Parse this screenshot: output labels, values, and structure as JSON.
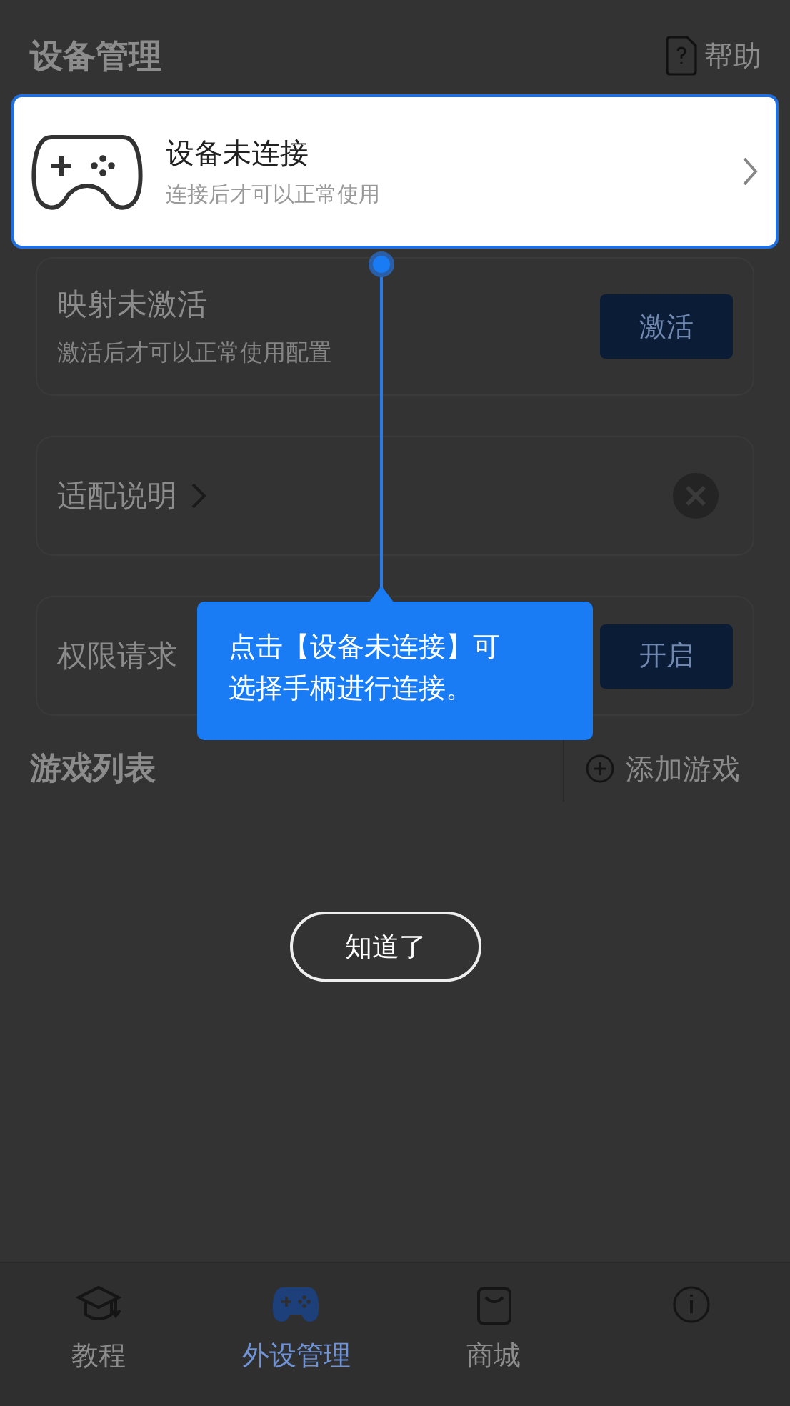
{
  "header": {
    "title": "设备管理",
    "help": "帮助"
  },
  "device_card": {
    "title": "设备未连接",
    "subtitle": "连接后才可以正常使用",
    "highlighted": true
  },
  "cards": [
    {
      "kind": "action",
      "title": "映射未激活",
      "subtitle": "激活后才可以正常使用配置",
      "button": "激活"
    },
    {
      "kind": "link",
      "title": "适配说明"
    },
    {
      "kind": "action",
      "title": "权限请求",
      "button": "开启"
    }
  ],
  "tooltip": {
    "text": "点击【设备未连接】可选择手柄进行连接。"
  },
  "game_list": {
    "title": "游戏列表",
    "add": "添加游戏"
  },
  "dismiss": "知道了",
  "tabs": [
    {
      "label": "教程",
      "selected": false
    },
    {
      "label": "外设管理",
      "selected": true
    },
    {
      "label": "商城",
      "selected": false
    },
    {
      "selected": false
    }
  ]
}
